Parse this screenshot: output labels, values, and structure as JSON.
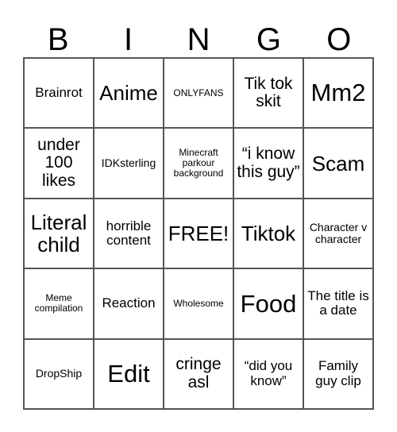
{
  "card": {
    "title_letters": [
      "B",
      "I",
      "N",
      "G",
      "O"
    ],
    "rows": [
      [
        {
          "text": "Brainrot",
          "size": "s-md"
        },
        {
          "text": "Anime",
          "size": "s-xl"
        },
        {
          "text": "ONLYFANS",
          "size": "s-xs"
        },
        {
          "text": "Tik tok skit",
          "size": "s-lg"
        },
        {
          "text": "Mm2",
          "size": "s-xxl"
        }
      ],
      [
        {
          "text": "under 100 likes",
          "size": "s-lg"
        },
        {
          "text": "IDKsterling",
          "size": "s-sm"
        },
        {
          "text": "Minecraft parkour background",
          "size": "s-xs"
        },
        {
          "text": "“i know this guy”",
          "size": "s-lg"
        },
        {
          "text": "Scam",
          "size": "s-xl"
        }
      ],
      [
        {
          "text": "Literal child",
          "size": "s-xl"
        },
        {
          "text": "horrible content",
          "size": "s-md"
        },
        {
          "text": "FREE!",
          "size": "s-xl"
        },
        {
          "text": "Tiktok",
          "size": "s-xl"
        },
        {
          "text": "Character v character",
          "size": "s-sm"
        }
      ],
      [
        {
          "text": "Meme compilation",
          "size": "s-xs"
        },
        {
          "text": "Reaction",
          "size": "s-md"
        },
        {
          "text": "Wholesome",
          "size": "s-xs"
        },
        {
          "text": "Food",
          "size": "s-xxl"
        },
        {
          "text": "The title is a date",
          "size": "s-md"
        }
      ],
      [
        {
          "text": "DropShip",
          "size": "s-sm"
        },
        {
          "text": "Edit",
          "size": "s-xxl"
        },
        {
          "text": "cringe asl",
          "size": "s-lg"
        },
        {
          "text": "“did you know”",
          "size": "s-md"
        },
        {
          "text": "Family guy clip",
          "size": "s-md"
        }
      ]
    ]
  },
  "colors": {
    "text": "#000000",
    "border": "#555555",
    "background": "#ffffff"
  }
}
